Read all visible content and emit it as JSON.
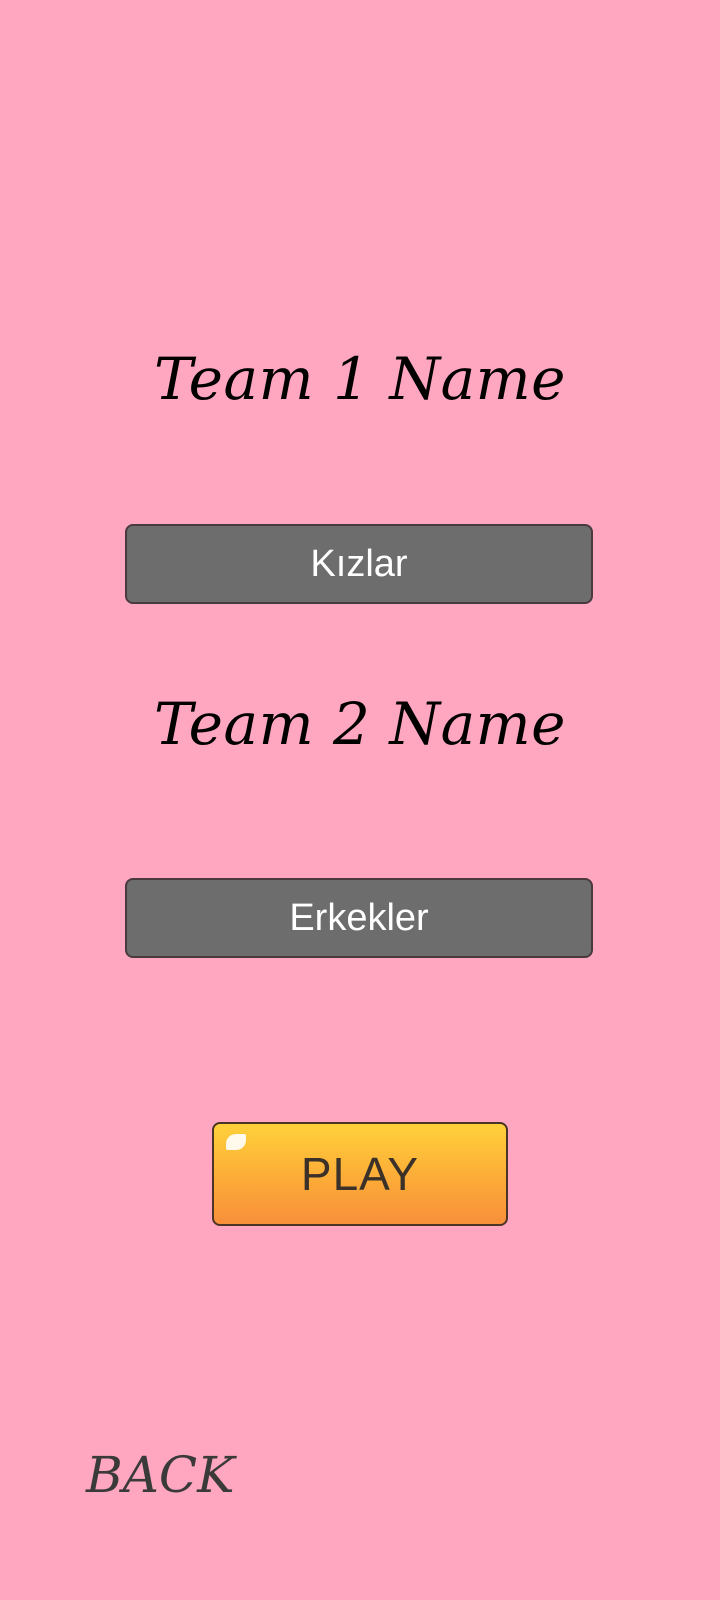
{
  "team1": {
    "label": "Team 1 Name",
    "value": "Kızlar"
  },
  "team2": {
    "label": "Team 2 Name",
    "value": "Erkekler"
  },
  "play_button": {
    "label": "PLAY"
  },
  "back_button": {
    "label": "BACK"
  },
  "colors": {
    "background": "#ffa7c0",
    "field": "#6d6d6d",
    "play_top": "#ffd13a",
    "play_bottom": "#f8903a"
  }
}
